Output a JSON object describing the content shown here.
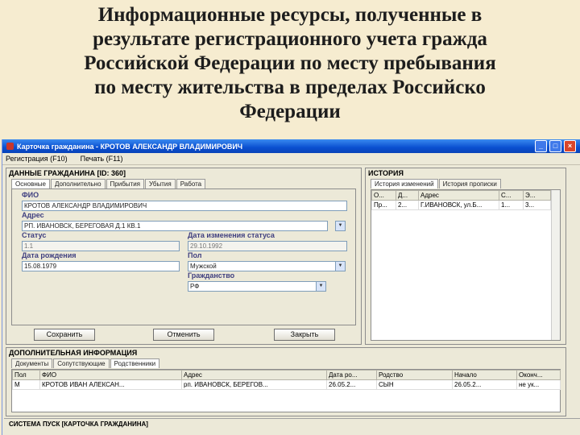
{
  "slide": {
    "title_lines": [
      "Информационные ресурсы, полученные в",
      "результате регистрационного учета гражда",
      "Российской Федерации по месту пребывания",
      "по месту жительства в пределах Российско",
      "Федерации"
    ]
  },
  "window": {
    "title": "Карточка гражданина - КРОТОВ АЛЕКСАНДР ВЛАДИМИРОВИЧ",
    "minimize": "_",
    "maximize": "□",
    "close": "×"
  },
  "menu": {
    "items": [
      "Регистрация (F10)",
      "Печать (F11)"
    ]
  },
  "citizen": {
    "header": "ДАННЫЕ ГРАЖДАНИНА [ID: 360]",
    "tabs": [
      "Основные",
      "Дополнительно",
      "Прибытия",
      "Убытия",
      "Работа"
    ],
    "fio_label": "ФИО",
    "fio_value": "КРОТОВ АЛЕКСАНДР ВЛАДИМИРОВИЧ",
    "address_label": "Адрес",
    "address_value": "РП. ИВАНОВСК, БЕРЕГОВАЯ Д.1 КВ.1",
    "status_label": "Статус",
    "status_value": "1.1",
    "status_date_label": "Дата изменения статуса",
    "status_date_value": "29.10.1992",
    "birth_label": "Дата рождения",
    "birth_value": "15.08.1979",
    "sex_label": "Пол",
    "sex_value": "Мужской",
    "citizenship_label": "Гражданство",
    "citizenship_value": "РФ",
    "save_button": "Сохранить",
    "cancel_button": "Отменить",
    "close_button": "Закрыть"
  },
  "history": {
    "header": "ИСТОРИЯ",
    "tabs": [
      "История изменений",
      "История прописки"
    ],
    "columns": [
      "О...",
      "Д...",
      "Адрес",
      "С...",
      "Э..."
    ],
    "rows": [
      [
        "Пр...",
        "2...",
        "Г.ИВАНОВСК, ул.Б...",
        "1...",
        "3..."
      ]
    ]
  },
  "additional": {
    "header": "ДОПОЛНИТЕЛЬНАЯ ИНФОРМАЦИЯ",
    "tabs": [
      "Документы",
      "Сопутствующие",
      "Родственники"
    ],
    "columns": [
      "Пол",
      "ФИО",
      "Адрес",
      "Дата ро...",
      "Родство",
      "Начало",
      "Оконч..."
    ],
    "rows": [
      [
        "М",
        "КРОТОВ ИВАН АЛЕКСАН...",
        "рп. ИВАНОВСК, БЕРЕГОВ...",
        "26.05.2...",
        "СЫН",
        "26.05.2...",
        "не ук..."
      ]
    ]
  },
  "statusbar": {
    "text": "СИСТЕМА ПУСК [КАРТОЧКА ГРАЖДАНИНА]"
  }
}
